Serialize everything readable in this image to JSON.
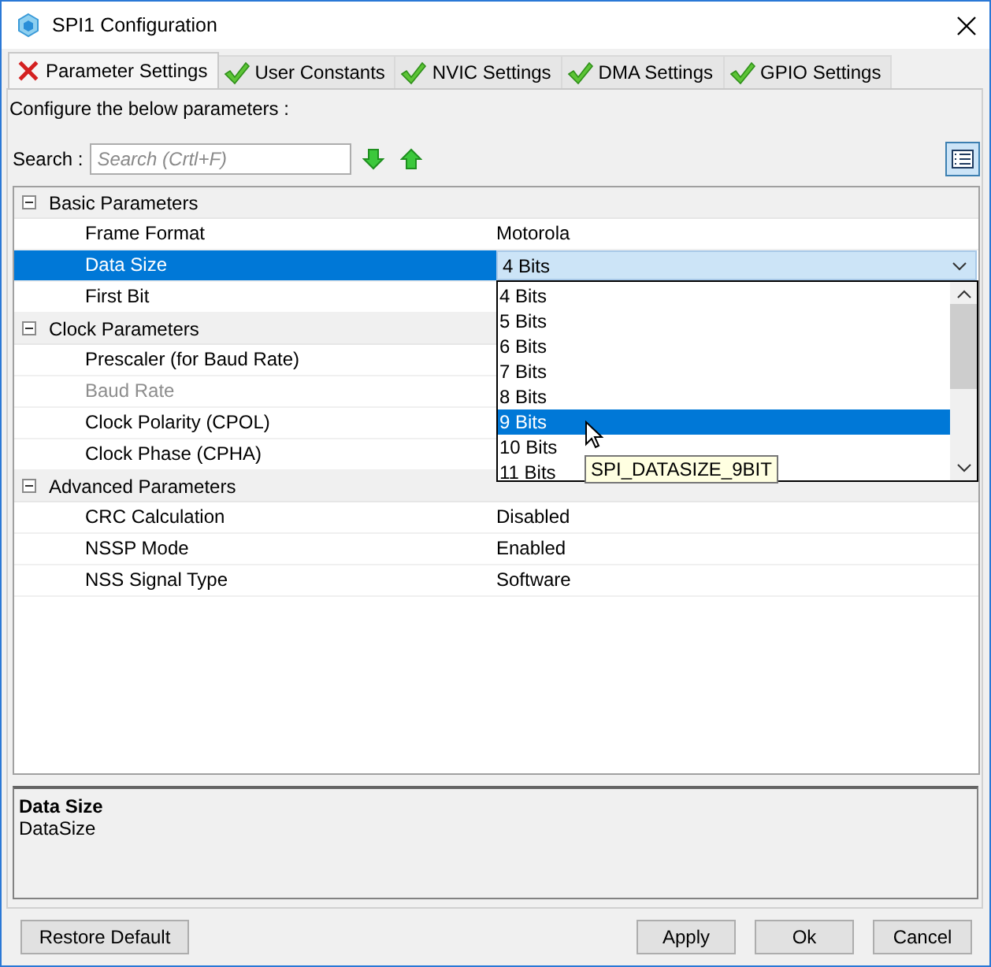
{
  "window": {
    "title": "SPI1 Configuration"
  },
  "tabs": [
    {
      "label": "Parameter Settings",
      "selected": true,
      "kind": "error"
    },
    {
      "label": "User Constants",
      "selected": false,
      "kind": "ok"
    },
    {
      "label": "NVIC Settings",
      "selected": false,
      "kind": "ok"
    },
    {
      "label": "DMA Settings",
      "selected": false,
      "kind": "ok"
    },
    {
      "label": "GPIO Settings",
      "selected": false,
      "kind": "ok"
    }
  ],
  "instruction": "Configure the below parameters :",
  "search": {
    "label": "Search :",
    "placeholder": "Search (Crtl+F)"
  },
  "groups": [
    {
      "label": "Basic Parameters",
      "expanded": true,
      "params": [
        {
          "name": "Frame Format",
          "value": "Motorola",
          "selected": false,
          "disabled": false,
          "kind": "text"
        },
        {
          "name": "Data Size",
          "value": "4 Bits",
          "selected": true,
          "disabled": false,
          "kind": "combo"
        },
        {
          "name": "First Bit",
          "selected": false,
          "disabled": false
        }
      ]
    },
    {
      "label": "Clock Parameters",
      "expanded": true,
      "params": [
        {
          "name": "Prescaler (for Baud Rate)",
          "selected": false,
          "disabled": false
        },
        {
          "name": "Baud Rate",
          "selected": false,
          "disabled": true
        },
        {
          "name": "Clock Polarity (CPOL)",
          "selected": false,
          "disabled": false
        },
        {
          "name": "Clock Phase (CPHA)",
          "selected": false,
          "disabled": false
        }
      ]
    },
    {
      "label": "Advanced Parameters",
      "expanded": true,
      "params": [
        {
          "name": "CRC Calculation",
          "value": "Disabled",
          "selected": false,
          "disabled": false,
          "kind": "text"
        },
        {
          "name": "NSSP Mode",
          "value": "Enabled",
          "selected": false,
          "disabled": false,
          "kind": "text"
        },
        {
          "name": "NSS Signal Type",
          "value": "Software",
          "selected": false,
          "disabled": false,
          "kind": "text"
        }
      ]
    }
  ],
  "dropdown": {
    "options": [
      {
        "label": "4 Bits",
        "selected": false
      },
      {
        "label": "5 Bits",
        "selected": false
      },
      {
        "label": "6 Bits",
        "selected": false
      },
      {
        "label": "7 Bits",
        "selected": false
      },
      {
        "label": "8 Bits",
        "selected": false
      },
      {
        "label": "9 Bits",
        "selected": true
      },
      {
        "label": "10 Bits",
        "selected": false
      },
      {
        "label": "11 Bits",
        "selected": false
      }
    ],
    "tooltip": "SPI_DATASIZE_9BIT"
  },
  "description": {
    "title": "Data Size",
    "text": "DataSize"
  },
  "buttons": [
    {
      "label": "Restore Default",
      "kind": "left"
    },
    {
      "label": "Apply",
      "kind": "right"
    },
    {
      "label": "Ok",
      "kind": "right"
    },
    {
      "label": "Cancel",
      "kind": "right"
    }
  ]
}
